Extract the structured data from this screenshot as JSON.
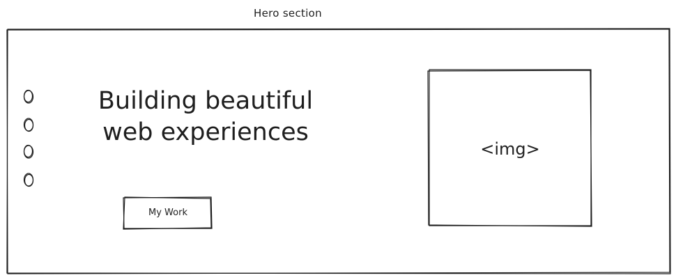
{
  "section_label": "Hero section",
  "hero": {
    "headline_line1": "Building beautiful",
    "headline_line2": "web experiences",
    "cta_label": "My Work",
    "image_placeholder": "<img>"
  },
  "slider_dots": {
    "count": 4
  },
  "colors": {
    "stroke": "#1e1e1e",
    "background": "#ffffff"
  }
}
